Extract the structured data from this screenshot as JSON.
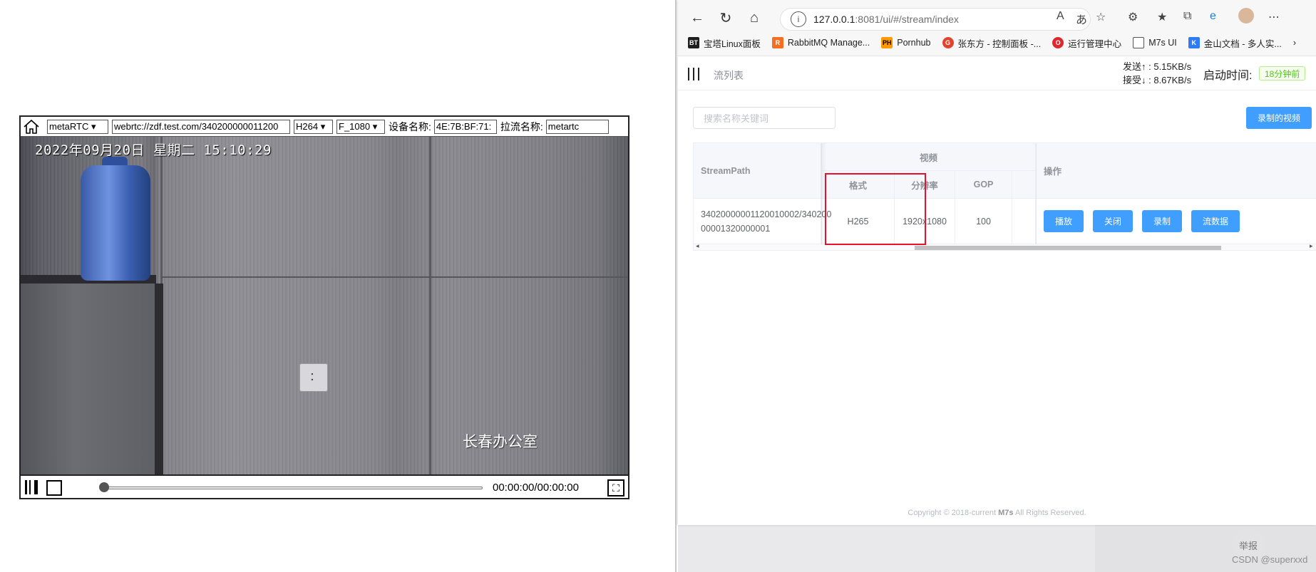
{
  "player": {
    "protocol_select": "metaRTC",
    "url_input": "webrtc://zdf.test.com/340200000011200",
    "codec_select": "H264",
    "resolution_select": "F_1080",
    "device_label": "设备名称:",
    "device_value": "4E:7B:BF:71:",
    "stream_label": "拉流名称:",
    "stream_value": "metartc",
    "osd_time": "2022年09月20日  星期二  15:10:29",
    "osd_location": "长春办公室",
    "time_display": "00:00:00/00:00:00",
    "progress": 0
  },
  "browser": {
    "url_host": "127.0.0.1",
    "url_rest": ":8081/ui/#/stream/index",
    "bookmarks": [
      {
        "label": "宝塔Linux面板",
        "icon": "BT",
        "color": "#1f1f1f"
      },
      {
        "label": "RabbitMQ Manage...",
        "icon": "R",
        "color": "#f46f20"
      },
      {
        "label": "Pornhub",
        "icon": "PH",
        "color": "#ff9900"
      },
      {
        "label": "张东方 - 控制面板 -...",
        "icon": "G",
        "color": "#e0442c"
      },
      {
        "label": "运行管理中心",
        "icon": "O",
        "color": "#e0262e"
      },
      {
        "label": "M7s UI",
        "icon": "doc",
        "color": "#ffffff"
      },
      {
        "label": "金山文档 - 多人实...",
        "icon": "K",
        "color": "#2e7bf6"
      }
    ]
  },
  "app": {
    "breadcrumb": "流列表",
    "send_rate": "发送↑ : 5.15KB/s",
    "recv_rate": "接受↓ : 8.67KB/s",
    "uptime_label": "启动时间:",
    "uptime_value": "18分钟前",
    "search_placeholder": "搜索名称关键词",
    "record_button": "录制的视频",
    "table": {
      "col_streampath": "StreamPath",
      "group_video": "视频",
      "col_format": "格式",
      "col_resolution": "分辨率",
      "col_gop": "GOP",
      "col_actions": "操作",
      "row": {
        "stream_path_line1": "34020000001120010002/340200",
        "stream_path_line2": "00001320000001",
        "format": "H265",
        "resolution": "1920x1080",
        "gop": "100"
      },
      "actions": [
        "播放",
        "关闭",
        "录制",
        "流数据"
      ]
    },
    "copyright_prefix": "Copyright © 2018-current ",
    "copyright_brand": "M7s",
    "copyright_suffix": " All Rights Reserved."
  },
  "overlay": {
    "report_button": "举报",
    "watermark": "CSDN @superxxd"
  },
  "colors": {
    "primary": "#409eff",
    "highlight": "#e8112d",
    "success": "#52c41a"
  }
}
